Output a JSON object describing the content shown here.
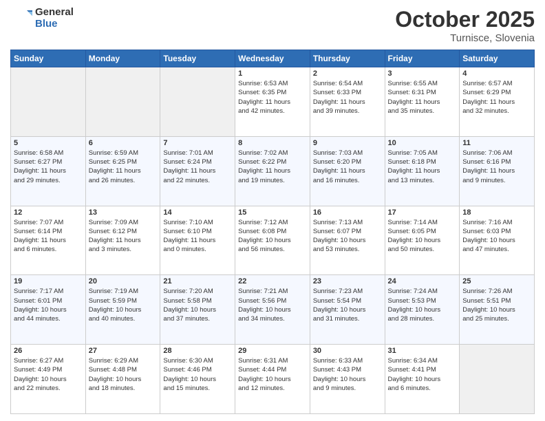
{
  "header": {
    "logo_general": "General",
    "logo_blue": "Blue",
    "month_title": "October 2025",
    "location": "Turnisce, Slovenia"
  },
  "weekdays": [
    "Sunday",
    "Monday",
    "Tuesday",
    "Wednesday",
    "Thursday",
    "Friday",
    "Saturday"
  ],
  "weeks": [
    [
      {
        "day": "",
        "info": ""
      },
      {
        "day": "",
        "info": ""
      },
      {
        "day": "",
        "info": ""
      },
      {
        "day": "1",
        "info": "Sunrise: 6:53 AM\nSunset: 6:35 PM\nDaylight: 11 hours\nand 42 minutes."
      },
      {
        "day": "2",
        "info": "Sunrise: 6:54 AM\nSunset: 6:33 PM\nDaylight: 11 hours\nand 39 minutes."
      },
      {
        "day": "3",
        "info": "Sunrise: 6:55 AM\nSunset: 6:31 PM\nDaylight: 11 hours\nand 35 minutes."
      },
      {
        "day": "4",
        "info": "Sunrise: 6:57 AM\nSunset: 6:29 PM\nDaylight: 11 hours\nand 32 minutes."
      }
    ],
    [
      {
        "day": "5",
        "info": "Sunrise: 6:58 AM\nSunset: 6:27 PM\nDaylight: 11 hours\nand 29 minutes."
      },
      {
        "day": "6",
        "info": "Sunrise: 6:59 AM\nSunset: 6:25 PM\nDaylight: 11 hours\nand 26 minutes."
      },
      {
        "day": "7",
        "info": "Sunrise: 7:01 AM\nSunset: 6:24 PM\nDaylight: 11 hours\nand 22 minutes."
      },
      {
        "day": "8",
        "info": "Sunrise: 7:02 AM\nSunset: 6:22 PM\nDaylight: 11 hours\nand 19 minutes."
      },
      {
        "day": "9",
        "info": "Sunrise: 7:03 AM\nSunset: 6:20 PM\nDaylight: 11 hours\nand 16 minutes."
      },
      {
        "day": "10",
        "info": "Sunrise: 7:05 AM\nSunset: 6:18 PM\nDaylight: 11 hours\nand 13 minutes."
      },
      {
        "day": "11",
        "info": "Sunrise: 7:06 AM\nSunset: 6:16 PM\nDaylight: 11 hours\nand 9 minutes."
      }
    ],
    [
      {
        "day": "12",
        "info": "Sunrise: 7:07 AM\nSunset: 6:14 PM\nDaylight: 11 hours\nand 6 minutes."
      },
      {
        "day": "13",
        "info": "Sunrise: 7:09 AM\nSunset: 6:12 PM\nDaylight: 11 hours\nand 3 minutes."
      },
      {
        "day": "14",
        "info": "Sunrise: 7:10 AM\nSunset: 6:10 PM\nDaylight: 11 hours\nand 0 minutes."
      },
      {
        "day": "15",
        "info": "Sunrise: 7:12 AM\nSunset: 6:08 PM\nDaylight: 10 hours\nand 56 minutes."
      },
      {
        "day": "16",
        "info": "Sunrise: 7:13 AM\nSunset: 6:07 PM\nDaylight: 10 hours\nand 53 minutes."
      },
      {
        "day": "17",
        "info": "Sunrise: 7:14 AM\nSunset: 6:05 PM\nDaylight: 10 hours\nand 50 minutes."
      },
      {
        "day": "18",
        "info": "Sunrise: 7:16 AM\nSunset: 6:03 PM\nDaylight: 10 hours\nand 47 minutes."
      }
    ],
    [
      {
        "day": "19",
        "info": "Sunrise: 7:17 AM\nSunset: 6:01 PM\nDaylight: 10 hours\nand 44 minutes."
      },
      {
        "day": "20",
        "info": "Sunrise: 7:19 AM\nSunset: 5:59 PM\nDaylight: 10 hours\nand 40 minutes."
      },
      {
        "day": "21",
        "info": "Sunrise: 7:20 AM\nSunset: 5:58 PM\nDaylight: 10 hours\nand 37 minutes."
      },
      {
        "day": "22",
        "info": "Sunrise: 7:21 AM\nSunset: 5:56 PM\nDaylight: 10 hours\nand 34 minutes."
      },
      {
        "day": "23",
        "info": "Sunrise: 7:23 AM\nSunset: 5:54 PM\nDaylight: 10 hours\nand 31 minutes."
      },
      {
        "day": "24",
        "info": "Sunrise: 7:24 AM\nSunset: 5:53 PM\nDaylight: 10 hours\nand 28 minutes."
      },
      {
        "day": "25",
        "info": "Sunrise: 7:26 AM\nSunset: 5:51 PM\nDaylight: 10 hours\nand 25 minutes."
      }
    ],
    [
      {
        "day": "26",
        "info": "Sunrise: 6:27 AM\nSunset: 4:49 PM\nDaylight: 10 hours\nand 22 minutes."
      },
      {
        "day": "27",
        "info": "Sunrise: 6:29 AM\nSunset: 4:48 PM\nDaylight: 10 hours\nand 18 minutes."
      },
      {
        "day": "28",
        "info": "Sunrise: 6:30 AM\nSunset: 4:46 PM\nDaylight: 10 hours\nand 15 minutes."
      },
      {
        "day": "29",
        "info": "Sunrise: 6:31 AM\nSunset: 4:44 PM\nDaylight: 10 hours\nand 12 minutes."
      },
      {
        "day": "30",
        "info": "Sunrise: 6:33 AM\nSunset: 4:43 PM\nDaylight: 10 hours\nand 9 minutes."
      },
      {
        "day": "31",
        "info": "Sunrise: 6:34 AM\nSunset: 4:41 PM\nDaylight: 10 hours\nand 6 minutes."
      },
      {
        "day": "",
        "info": ""
      }
    ]
  ]
}
